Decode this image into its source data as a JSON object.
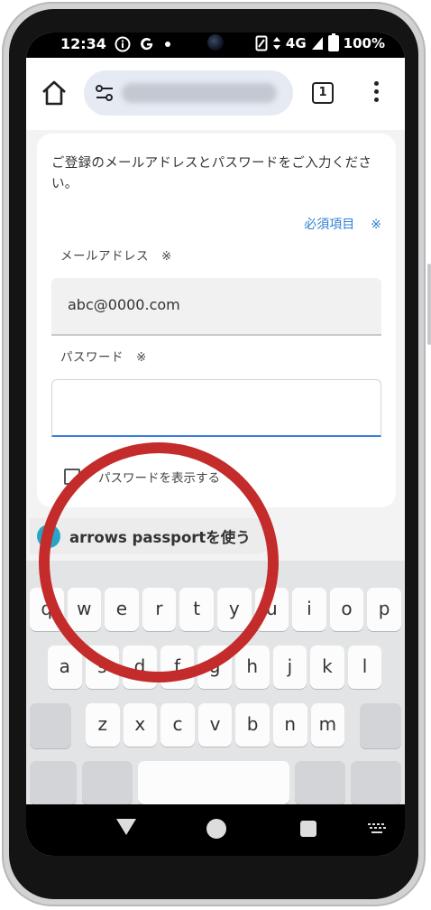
{
  "status_bar": {
    "time": "12:34",
    "network": "4G",
    "battery": "100%",
    "icons": [
      "info-icon",
      "google-icon",
      "dot-icon",
      "nfc-icon",
      "data-arrows-icon",
      "signal-icon",
      "battery-icon"
    ]
  },
  "browser": {
    "tab_count": "1"
  },
  "form": {
    "intro": "ご登録のメールアドレスとパスワードをご入力ください。",
    "required_label": "必須項目",
    "required_mark": "※",
    "email_label": "メールアドレス",
    "email_mark": "※",
    "email_value": "abc@0000.com",
    "password_label": "パスワード",
    "password_mark": "※",
    "password_value": "",
    "show_password_label": "パスワードを表示する",
    "show_password_checked": false
  },
  "suggestion": {
    "text": "arrows passportを使う"
  },
  "keyboard": {
    "row1": [
      "q",
      "w",
      "e",
      "r",
      "t",
      "y",
      "u",
      "i",
      "o",
      "p"
    ],
    "row2": [
      "a",
      "s",
      "d",
      "f",
      "g",
      "h",
      "j",
      "k",
      "l"
    ],
    "row3": [
      "z",
      "x",
      "c",
      "v",
      "b",
      "n",
      "m"
    ]
  },
  "colors": {
    "accent_blue": "#2f80d1",
    "annotation_red": "#c42b2b",
    "passport_icon": "#25a6c9"
  }
}
